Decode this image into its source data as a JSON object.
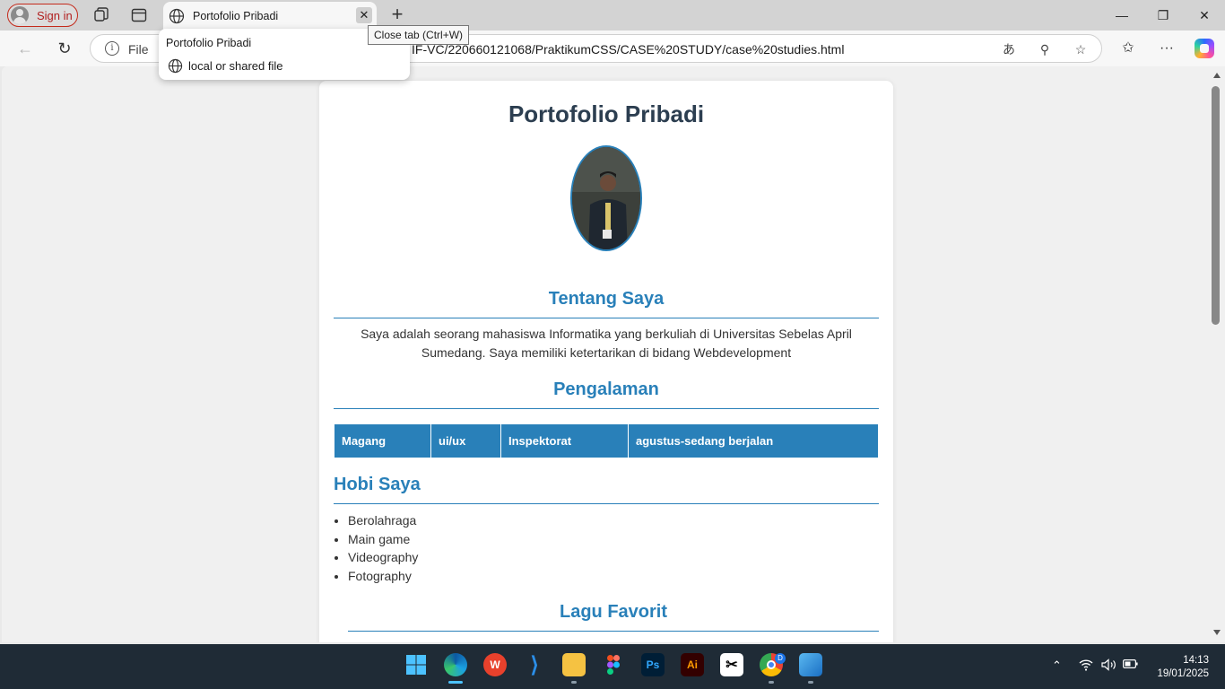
{
  "browser": {
    "signin_label": "Sign in",
    "tab_title": "Portofolio Pribadi",
    "tab_close_tooltip": "Close tab (Ctrl+W)",
    "hovercard": {
      "title": "Portofolio Pribadi",
      "source": "local or shared file"
    },
    "address": {
      "scheme_label": "File",
      "url": "IF-VC/220660121068/PraktikumCSS/CASE%20STUDY/case%20studies.html"
    },
    "icons": [
      "workspaces-icon",
      "tab-actions-icon",
      "back-icon",
      "refresh-icon",
      "read-aloud-icon",
      "zoom-icon",
      "favorite-icon",
      "favorites-icon",
      "more-icon",
      "copilot-icon"
    ]
  },
  "page": {
    "title": "Portofolio Pribadi",
    "about": {
      "heading": "Tentang Saya",
      "text": "Saya adalah seorang mahasiswa Informatika yang berkuliah di Universitas Sebelas April Sumedang. Saya memiliki ketertarikan di bidang Webdevelopment"
    },
    "experience": {
      "heading": "Pengalaman",
      "rows": [
        [
          "Magang",
          "ui/ux",
          "Inspektorat",
          "agustus-sedang berjalan"
        ]
      ]
    },
    "hobbies": {
      "heading": "Hobi Saya",
      "items": [
        "Berolahraga",
        "Main game",
        "Videography",
        "Fotography"
      ]
    },
    "songs": {
      "heading": "Lagu Favorit"
    }
  },
  "taskbar": {
    "apps": [
      "start",
      "edge",
      "wps-office",
      "vscode",
      "file-explorer",
      "figma",
      "photoshop",
      "illustrator",
      "capcut",
      "chrome",
      "photos"
    ],
    "chrome_badge": "D",
    "time": "14:13",
    "date": "19/01/2025"
  },
  "colors": {
    "accent": "#2980b9",
    "heading": "#2c3e50",
    "signin": "#c42b1c"
  }
}
